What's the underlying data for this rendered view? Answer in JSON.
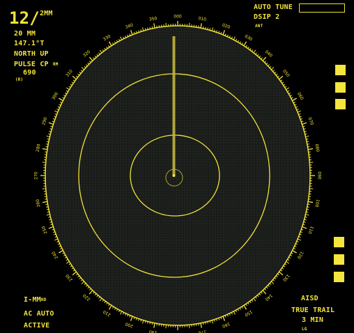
{
  "colors": {
    "accent": "#f2e23a",
    "background": "#000000",
    "scope": "#171a17"
  },
  "top_left": {
    "range_value": "12/",
    "range_unit": "2MM",
    "range_scale": "20 MM",
    "heading": "147.1°T",
    "orientation": "NORTH UP",
    "pulse": "PULSE CP",
    "pulse_superscript": "RM",
    "gain": "690",
    "gain_sub": "(R)"
  },
  "top_right": {
    "tune": "AUTO TUNE",
    "display": "DSIP 2",
    "ant": "ANT"
  },
  "bottom_left": {
    "ebl": "I-MM",
    "ebl_superscript": "ND",
    "ac": "AC AUTO",
    "status": "ACTIVE"
  },
  "bottom_right": {
    "ais": "AISD",
    "trail": "TRUE TRAIL",
    "trail_time": "3 MIN",
    "trail_sub": "LG"
  },
  "side_tiles": {
    "upper_count": 3,
    "lower_count": 3,
    "icon": "menu-tile-icon"
  },
  "bearing_labels": [
    "000",
    "010",
    "020",
    "030",
    "040",
    "050",
    "060",
    "070",
    "080",
    "090",
    "100",
    "110",
    "120",
    "130",
    "140",
    "150",
    "160",
    "170",
    "180",
    "190",
    "200",
    "210",
    "220",
    "230",
    "240",
    "250",
    "260",
    "270",
    "280",
    "290",
    "300",
    "310",
    "320",
    "330",
    "340",
    "350"
  ],
  "scope": {
    "heading_line_bearing": 0
  }
}
